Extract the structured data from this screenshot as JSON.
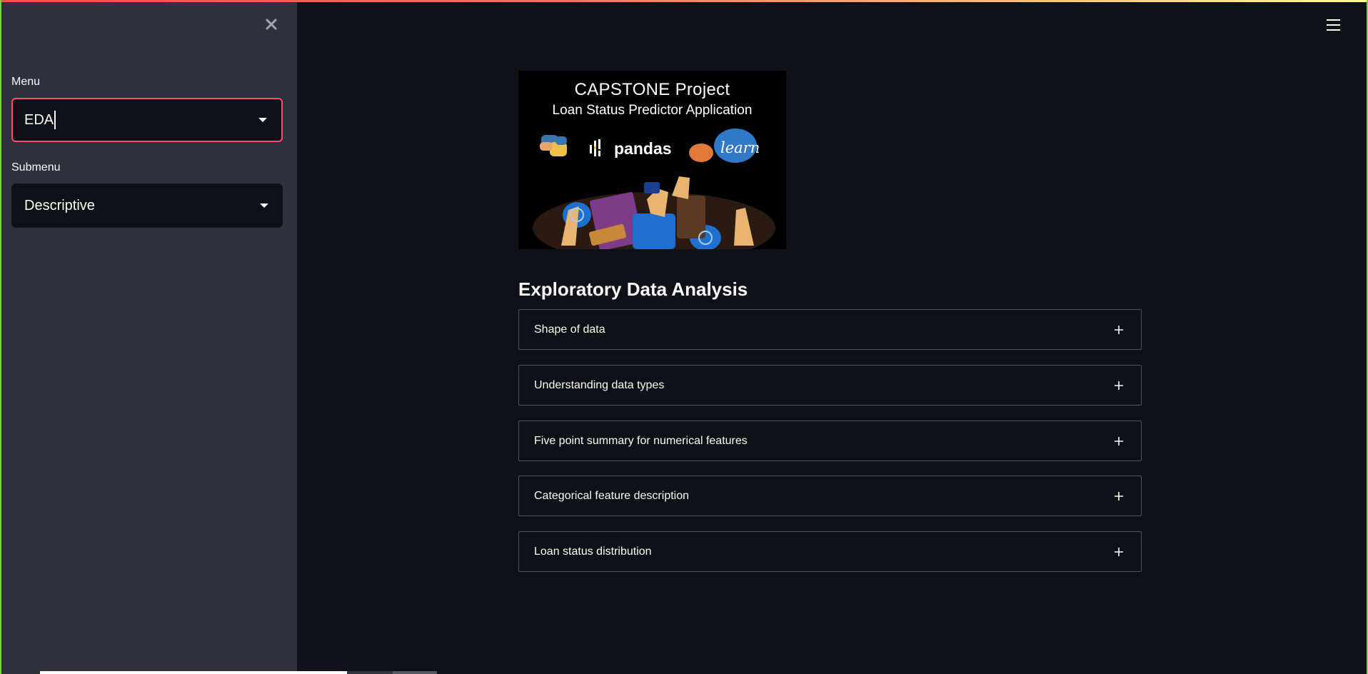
{
  "sidebar": {
    "menu": {
      "label": "Menu",
      "value": "EDA"
    },
    "submenu": {
      "label": "Submenu",
      "value": "Descriptive"
    },
    "close_icon": "close-icon"
  },
  "header": {
    "menu_icon": "hamburger-menu-icon"
  },
  "banner": {
    "title": "CAPSTONE Project",
    "subtitle": "Loan Status Predictor Application",
    "pandas_text": "pandas",
    "sklearn_text": "learn"
  },
  "main": {
    "title": "Exploratory Data Analysis",
    "expanders": [
      {
        "label": "Shape of data"
      },
      {
        "label": "Understanding data types"
      },
      {
        "label": "Five point summary for numerical features"
      },
      {
        "label": "Categorical feature description"
      },
      {
        "label": "Loan status distribution"
      }
    ]
  },
  "colors": {
    "accent": "#ff4b6e",
    "background": "#0e1117",
    "sidebar": "#2f313c",
    "text": "#fafafa"
  }
}
